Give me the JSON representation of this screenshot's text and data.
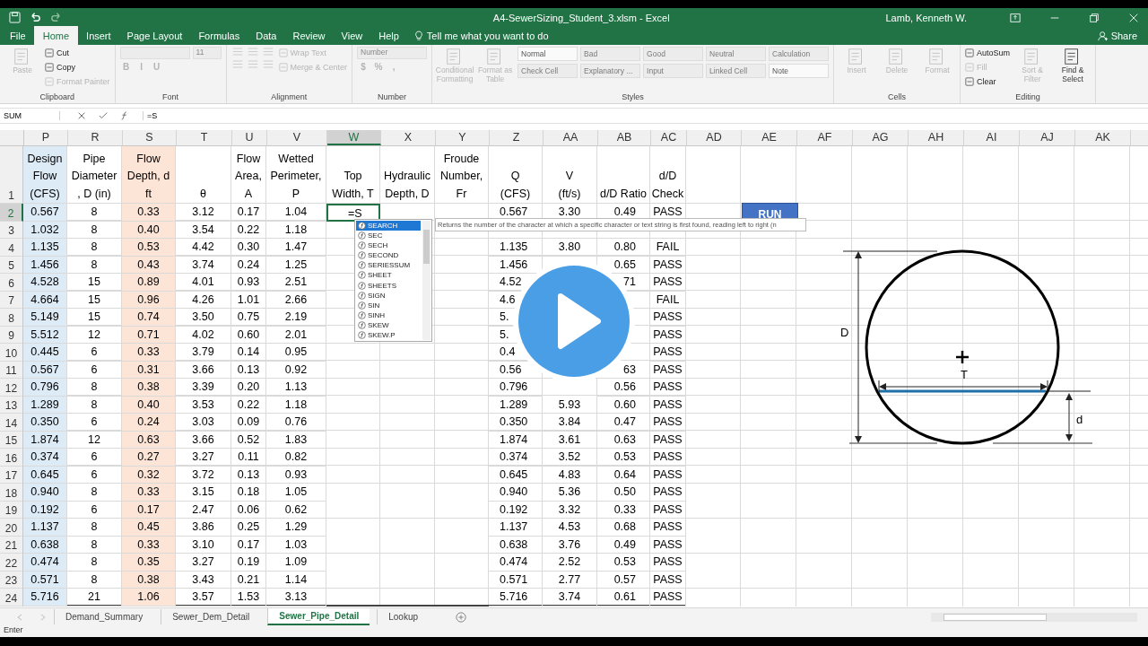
{
  "title_bar": {
    "title": "A4-SewerSizing_Student_3.xlsm  -  Excel",
    "user": "Lamb, Kenneth W."
  },
  "menu_tabs": [
    {
      "label": "File",
      "selected": false
    },
    {
      "label": "Home",
      "selected": true
    },
    {
      "label": "Insert",
      "selected": false
    },
    {
      "label": "Page Layout",
      "selected": false
    },
    {
      "label": "Formulas",
      "selected": false
    },
    {
      "label": "Data",
      "selected": false
    },
    {
      "label": "Review",
      "selected": false
    },
    {
      "label": "View",
      "selected": false
    },
    {
      "label": "Help",
      "selected": false
    }
  ],
  "tell_me": "Tell me what you want to do",
  "share": "Share",
  "ribbon": [
    {
      "name": "Clipboard",
      "columns": [
        [
          [
            {
              "kind": "large",
              "label": "Paste",
              "disabled": true
            }
          ]
        ],
        [
          [
            {
              "kind": "small",
              "label": "Cut",
              "disabled": false
            }
          ],
          [
            {
              "kind": "small",
              "label": "Copy",
              "disabled": false
            }
          ],
          [
            {
              "kind": "small",
              "label": "Format Painter",
              "disabled": true
            }
          ]
        ]
      ]
    },
    {
      "name": "Font",
      "columns": [
        [
          [
            {
              "kind": "field",
              "disabled": true
            },
            {
              "kind": "field",
              "label": "11",
              "disabled": true
            }
          ],
          [
            {
              "kind": "glyph",
              "label": "B",
              "disabled": true
            },
            {
              "kind": "glyph",
              "label": "I",
              "disabled": true
            },
            {
              "kind": "glyph",
              "label": "U",
              "disabled": true
            }
          ]
        ]
      ]
    },
    {
      "name": "Alignment",
      "columns": [
        [
          [
            {
              "kind": "icon",
              "disabled": true
            },
            {
              "kind": "icon",
              "disabled": true
            },
            {
              "kind": "icon",
              "disabled": true
            }
          ],
          [
            {
              "kind": "icon",
              "disabled": true
            },
            {
              "kind": "icon",
              "disabled": true
            },
            {
              "kind": "icon",
              "disabled": true
            }
          ]
        ],
        [
          [
            {
              "kind": "small",
              "label": "Wrap Text",
              "disabled": true
            }
          ],
          [
            {
              "kind": "small",
              "label": "Merge & Center",
              "disabled": true
            }
          ]
        ]
      ]
    },
    {
      "name": "Number",
      "columns": [
        [
          [
            {
              "kind": "field",
              "label": "Number",
              "disabled": true
            }
          ],
          [
            {
              "kind": "glyph",
              "label": "$",
              "disabled": true
            },
            {
              "kind": "glyph",
              "label": "%",
              "disabled": true
            },
            {
              "kind": "glyph",
              "label": ",",
              "disabled": true
            }
          ]
        ]
      ]
    },
    {
      "name": "Styles",
      "columns": [
        [
          [
            {
              "kind": "large",
              "label": "Conditional Formatting",
              "disabled": true
            }
          ]
        ],
        [
          [
            {
              "kind": "large",
              "label": "Format as Table",
              "disabled": true
            }
          ]
        ],
        [
          [
            {
              "kind": "style",
              "label": "Normal",
              "disabled": false
            },
            {
              "kind": "style",
              "label": "Bad",
              "disabled": true
            },
            {
              "kind": "style",
              "label": "Good",
              "disabled": true
            },
            {
              "kind": "style",
              "label": "Neutral",
              "disabled": true
            },
            {
              "kind": "style",
              "label": "Calculation",
              "disabled": true
            }
          ],
          [
            {
              "kind": "style",
              "label": "Check Cell",
              "disabled": true
            },
            {
              "kind": "style",
              "label": "Explanatory ...",
              "disabled": true
            },
            {
              "kind": "style",
              "label": "Input",
              "disabled": true
            },
            {
              "kind": "style",
              "label": "Linked Cell",
              "disabled": true
            },
            {
              "kind": "style",
              "label": "Note",
              "disabled": false
            }
          ]
        ]
      ]
    },
    {
      "name": "Cells",
      "columns": [
        [
          [
            {
              "kind": "large",
              "label": "Insert",
              "disabled": true
            }
          ]
        ],
        [
          [
            {
              "kind": "large",
              "label": "Delete",
              "disabled": true
            }
          ]
        ],
        [
          [
            {
              "kind": "large",
              "label": "Format",
              "disabled": true
            }
          ]
        ]
      ]
    },
    {
      "name": "Editing",
      "columns": [
        [
          [
            {
              "kind": "small",
              "label": "AutoSum",
              "disabled": false
            }
          ],
          [
            {
              "kind": "small",
              "label": "Fill",
              "disabled": true
            }
          ],
          [
            {
              "kind": "small",
              "label": "Clear",
              "disabled": false
            }
          ]
        ],
        [
          [
            {
              "kind": "large",
              "label": "Sort & Filter",
              "disabled": true
            }
          ]
        ],
        [
          [
            {
              "kind": "large",
              "label": "Find & Select",
              "disabled": false
            }
          ]
        ]
      ]
    }
  ],
  "formula_bar": {
    "name_box": "SUM",
    "formula": "=S"
  },
  "columns": [
    {
      "letter": "P",
      "header": "Design\nFlow\n(CFS)",
      "color": "#ddebf7",
      "selected": false
    },
    {
      "letter": "R",
      "header": "Pipe\nDiameter\n, D (in)",
      "selected": false
    },
    {
      "letter": "S",
      "header": "Flow\nDepth, d\nft",
      "color": "#fce4d6",
      "selected": false
    },
    {
      "letter": "T",
      "header": "θ",
      "selected": false
    },
    {
      "letter": "U",
      "header": "Flow\nArea,\nA",
      "selected": false
    },
    {
      "letter": "V",
      "header": "Wetted\nPerimeter,\nP",
      "selected": false
    },
    {
      "letter": "W",
      "header": "Top\nWidth, T",
      "selected": true
    },
    {
      "letter": "X",
      "header": "Hydraulic\nDepth, D",
      "selected": false
    },
    {
      "letter": "Y",
      "header": "Froude\nNumber,\nFr",
      "selected": false
    },
    {
      "letter": "Z",
      "header": "Q\n(CFS)",
      "selected": false
    },
    {
      "letter": "AA",
      "header": "V\n(ft/s)",
      "selected": false
    },
    {
      "letter": "AB",
      "header": "d/D Ratio",
      "selected": false
    },
    {
      "letter": "AC",
      "header": "d/D\nCheck",
      "selected": false
    },
    {
      "letter": "AD",
      "selected": false
    },
    {
      "letter": "AE",
      "selected": false
    },
    {
      "letter": "AF",
      "selected": false
    },
    {
      "letter": "AG",
      "selected": false
    },
    {
      "letter": "AH",
      "selected": false
    },
    {
      "letter": "AI",
      "selected": false
    },
    {
      "letter": "AJ",
      "selected": false
    },
    {
      "letter": "AK",
      "selected": false
    }
  ],
  "header_row_number": "1",
  "rows": [
    {
      "number": "2",
      "selected": true,
      "cells": [
        "0.567",
        "8",
        "0.33",
        "3.12",
        "0.17",
        "1.04",
        "=S",
        null,
        null,
        "0.567",
        "3.30",
        "0.49",
        "PASS"
      ]
    },
    {
      "number": "3",
      "selected": false,
      "cells": [
        "1.032",
        "8",
        "0.40",
        "3.54",
        "0.22",
        "1.18",
        null,
        null,
        null,
        null,
        null,
        null,
        null
      ]
    },
    {
      "number": "4",
      "selected": false,
      "cells": [
        "1.135",
        "8",
        "0.53",
        "4.42",
        "0.30",
        "1.47",
        null,
        null,
        null,
        "1.135",
        "3.80",
        "0.80",
        "FAIL"
      ]
    },
    {
      "number": "5",
      "selected": false,
      "cells": [
        "1.456",
        "8",
        "0.43",
        "3.74",
        "0.24",
        "1.25",
        null,
        null,
        null,
        "1.456",
        null,
        "0.65",
        "PASS"
      ]
    },
    {
      "number": "6",
      "selected": false,
      "cells": [
        "4.528",
        "15",
        "0.89",
        "4.01",
        "0.93",
        "2.51",
        null,
        null,
        null,
        "4.52",
        null,
        "71",
        "PASS"
      ]
    },
    {
      "number": "7",
      "selected": false,
      "cells": [
        "4.664",
        "15",
        "0.96",
        "4.26",
        "1.01",
        "2.66",
        null,
        null,
        null,
        "4.6",
        null,
        null,
        "FAIL"
      ]
    },
    {
      "number": "8",
      "selected": false,
      "cells": [
        "5.149",
        "15",
        "0.74",
        "3.50",
        "0.75",
        "2.19",
        null,
        null,
        null,
        "5.",
        null,
        null,
        "PASS"
      ]
    },
    {
      "number": "9",
      "selected": false,
      "cells": [
        "5.512",
        "12",
        "0.71",
        "4.02",
        "0.60",
        "2.01",
        null,
        null,
        null,
        "5.",
        null,
        null,
        "PASS"
      ]
    },
    {
      "number": "10",
      "selected": false,
      "cells": [
        "0.445",
        "6",
        "0.33",
        "3.79",
        "0.14",
        "0.95",
        null,
        null,
        null,
        "0.4",
        null,
        null,
        "PASS"
      ]
    },
    {
      "number": "11",
      "selected": false,
      "cells": [
        "0.567",
        "6",
        "0.31",
        "3.66",
        "0.13",
        "0.92",
        null,
        null,
        null,
        "0.56",
        null,
        "63",
        "PASS"
      ]
    },
    {
      "number": "12",
      "selected": false,
      "cells": [
        "0.796",
        "8",
        "0.38",
        "3.39",
        "0.20",
        "1.13",
        null,
        null,
        null,
        "0.796",
        null,
        "0.56",
        "PASS"
      ]
    },
    {
      "number": "13",
      "selected": false,
      "cells": [
        "1.289",
        "8",
        "0.40",
        "3.53",
        "0.22",
        "1.18",
        null,
        null,
        null,
        "1.289",
        "5.93",
        "0.60",
        "PASS"
      ]
    },
    {
      "number": "14",
      "selected": false,
      "cells": [
        "0.350",
        "6",
        "0.24",
        "3.03",
        "0.09",
        "0.76",
        null,
        null,
        null,
        "0.350",
        "3.84",
        "0.47",
        "PASS"
      ]
    },
    {
      "number": "15",
      "selected": false,
      "cells": [
        "1.874",
        "12",
        "0.63",
        "3.66",
        "0.52",
        "1.83",
        null,
        null,
        null,
        "1.874",
        "3.61",
        "0.63",
        "PASS"
      ]
    },
    {
      "number": "16",
      "selected": false,
      "cells": [
        "0.374",
        "6",
        "0.27",
        "3.27",
        "0.11",
        "0.82",
        null,
        null,
        null,
        "0.374",
        "3.52",
        "0.53",
        "PASS"
      ]
    },
    {
      "number": "17",
      "selected": false,
      "cells": [
        "0.645",
        "6",
        "0.32",
        "3.72",
        "0.13",
        "0.93",
        null,
        null,
        null,
        "0.645",
        "4.83",
        "0.64",
        "PASS"
      ]
    },
    {
      "number": "18",
      "selected": false,
      "cells": [
        "0.940",
        "8",
        "0.33",
        "3.15",
        "0.18",
        "1.05",
        null,
        null,
        null,
        "0.940",
        "5.36",
        "0.50",
        "PASS"
      ]
    },
    {
      "number": "19",
      "selected": false,
      "cells": [
        "0.192",
        "6",
        "0.17",
        "2.47",
        "0.06",
        "0.62",
        null,
        null,
        null,
        "0.192",
        "3.32",
        "0.33",
        "PASS"
      ]
    },
    {
      "number": "20",
      "selected": false,
      "cells": [
        "1.137",
        "8",
        "0.45",
        "3.86",
        "0.25",
        "1.29",
        null,
        null,
        null,
        "1.137",
        "4.53",
        "0.68",
        "PASS"
      ]
    },
    {
      "number": "21",
      "selected": false,
      "cells": [
        "0.638",
        "8",
        "0.33",
        "3.10",
        "0.17",
        "1.03",
        null,
        null,
        null,
        "0.638",
        "3.76",
        "0.49",
        "PASS"
      ]
    },
    {
      "number": "22",
      "selected": false,
      "cells": [
        "0.474",
        "8",
        "0.35",
        "3.27",
        "0.19",
        "1.09",
        null,
        null,
        null,
        "0.474",
        "2.52",
        "0.53",
        "PASS"
      ]
    },
    {
      "number": "23",
      "selected": false,
      "cells": [
        "0.571",
        "8",
        "0.38",
        "3.43",
        "0.21",
        "1.14",
        null,
        null,
        null,
        "0.571",
        "2.77",
        "0.57",
        "PASS"
      ]
    },
    {
      "number": "24",
      "selected": false,
      "cells": [
        "5.716",
        "21",
        "1.06",
        "3.57",
        "1.53",
        "3.13",
        null,
        null,
        null,
        "5.716",
        "3.74",
        "0.61",
        "PASS"
      ]
    }
  ],
  "run_button": "RUN",
  "autocomplete": {
    "items": [
      {
        "label": "SEARCH",
        "selected": true
      },
      {
        "label": "SEC",
        "selected": false
      },
      {
        "label": "SECH",
        "selected": false
      },
      {
        "label": "SECOND",
        "selected": false
      },
      {
        "label": "SERIESSUM",
        "selected": false
      },
      {
        "label": "SHEET",
        "selected": false
      },
      {
        "label": "SHEETS",
        "selected": false
      },
      {
        "label": "SIGN",
        "selected": false
      },
      {
        "label": "SIN",
        "selected": false
      },
      {
        "label": "SINH",
        "selected": false
      },
      {
        "label": "SKEW",
        "selected": false
      },
      {
        "label": "SKEW.P",
        "selected": false
      }
    ],
    "tooltip": "Returns the number of the character at which a specific character or text string is first found, reading left to right (n"
  },
  "diagram": {
    "diameter_label": "D",
    "top_width_label": "T",
    "depth_label": "d"
  },
  "sheet_tabs": [
    {
      "label": "Demand_Summary",
      "selected": false
    },
    {
      "label": "Sewer_Dem_Detail",
      "selected": false
    },
    {
      "label": "Sewer_Pipe_Detail",
      "selected": true
    },
    {
      "label": "Lookup",
      "selected": false
    }
  ],
  "status": "Enter"
}
